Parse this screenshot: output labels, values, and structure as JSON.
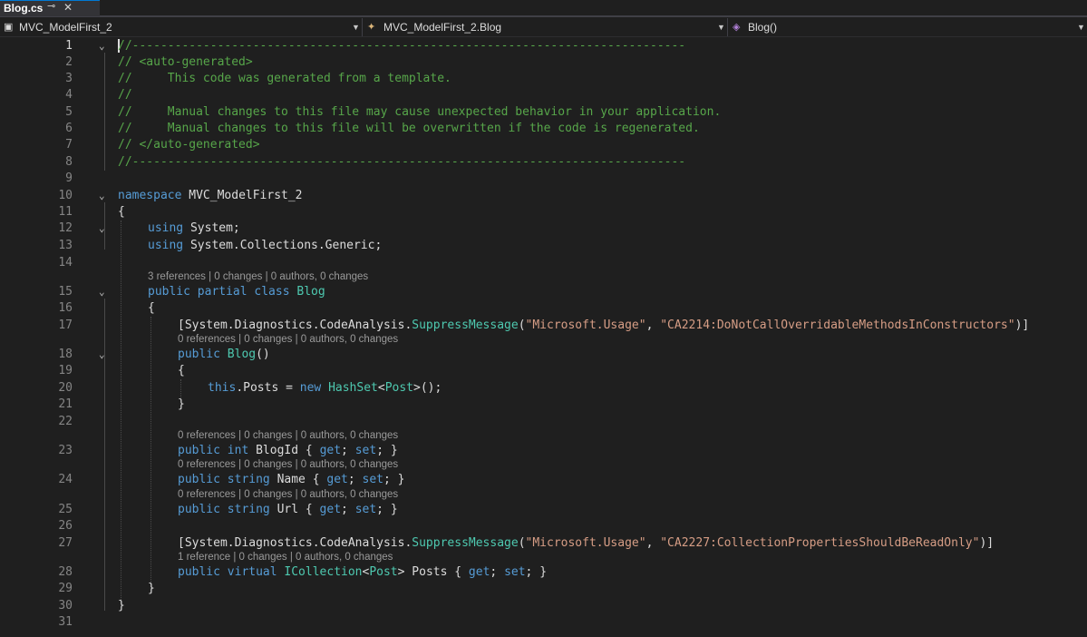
{
  "tab": {
    "title": "Blog.cs",
    "pin": "⊸",
    "close": "✕"
  },
  "nav": {
    "project": "MVC_ModelFirst_2",
    "type": "MVC_ModelFirst_2.Blog",
    "member": "Blog()"
  },
  "lines": {
    "l1": "//------------------------------------------------------------------------------",
    "l2": "// <auto-generated>",
    "l3": "//     This code was generated from a template.",
    "l4": "//",
    "l5": "//     Manual changes to this file may cause unexpected behavior in your application.",
    "l6": "//     Manual changes to this file will be overwritten if the code is regenerated.",
    "l7": "// </auto-generated>",
    "l8": "//------------------------------------------------------------------------------",
    "l10_kw": "namespace",
    "l10_name": " MVC_ModelFirst_2",
    "l11": "{",
    "l12_kw": "using",
    "l12_rest": " System;",
    "l13_kw": "using",
    "l13_rest": " System.Collections.Generic;",
    "l15_kw": "public partial class",
    "l15_name": " Blog",
    "l16": "{",
    "l17_a": "[System.Diagnostics.CodeAnalysis.",
    "l17_type": "SuppressMessage",
    "l17_b": "(",
    "l17_s1": "\"Microsoft.Usage\"",
    "l17_c": ", ",
    "l17_s2": "\"CA2214:DoNotCallOverridableMethodsInConstructors\"",
    "l17_d": ")]",
    "l18_kw": "public",
    "l18_name": " Blog",
    "l18_rest": "()",
    "l19": "{",
    "l20_kw": "this",
    "l20_a": ".Posts = ",
    "l20_new": "new",
    "l20_sp": " ",
    "l20_t1": "HashSet",
    "l20_lt": "<",
    "l20_t2": "Post",
    "l20_end": ">();",
    "l21": "}",
    "l23_kw": "public int",
    "l23_a": " BlogId { ",
    "l23_get": "get",
    "l23_b": "; ",
    "l23_set": "set",
    "l23_c": "; }",
    "l24_kw": "public string",
    "l24_a": " Name { ",
    "l24_get": "get",
    "l24_b": "; ",
    "l24_set": "set",
    "l24_c": "; }",
    "l25_kw": "public string",
    "l25_a": " Url { ",
    "l25_get": "get",
    "l25_b": "; ",
    "l25_set": "set",
    "l25_c": "; }",
    "l27_a": "[System.Diagnostics.CodeAnalysis.",
    "l27_type": "SuppressMessage",
    "l27_b": "(",
    "l27_s1": "\"Microsoft.Usage\"",
    "l27_c": ", ",
    "l27_s2": "\"CA2227:CollectionPropertiesShouldBeReadOnly\"",
    "l27_d": ")]",
    "l28_kw": "public virtual",
    "l28_sp": " ",
    "l28_t1": "ICollection",
    "l28_lt": "<",
    "l28_t2": "Post",
    "l28_a": "> Posts { ",
    "l28_get": "get",
    "l28_b": "; ",
    "l28_set": "set",
    "l28_c": "; }",
    "l29": "}",
    "l30": "}"
  },
  "lens": {
    "blog_class": "3 references | 0 changes | 0 authors, 0 changes",
    "ctor": "0 references | 0 changes | 0 authors, 0 changes",
    "blogid": "0 references | 0 changes | 0 authors, 0 changes",
    "name": "0 references | 0 changes | 0 authors, 0 changes",
    "url": "0 references | 0 changes | 0 authors, 0 changes",
    "posts": "1 reference | 0 changes | 0 authors, 0 changes"
  },
  "line_numbers": [
    "1",
    "2",
    "3",
    "4",
    "5",
    "6",
    "7",
    "8",
    "9",
    "10",
    "11",
    "12",
    "13",
    "14",
    "15",
    "16",
    "17",
    "18",
    "19",
    "20",
    "21",
    "22",
    "23",
    "24",
    "25",
    "26",
    "27",
    "28",
    "29",
    "30",
    "31"
  ],
  "colors": {
    "comment": "#57a64a",
    "keyword": "#569cd6",
    "type": "#4ec9b0",
    "string": "#d69d85",
    "background": "#1f1f1f"
  }
}
